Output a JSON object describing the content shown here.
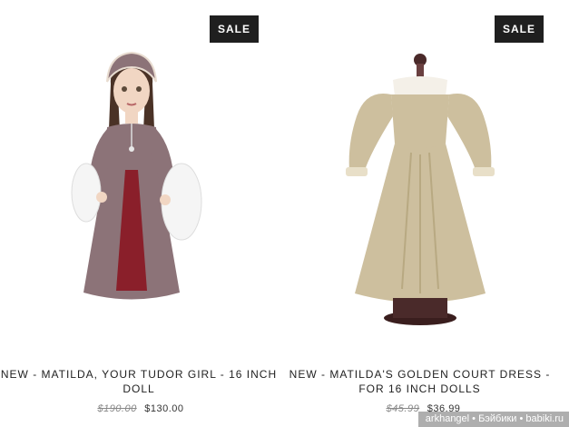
{
  "products": [
    {
      "badge": "SALE",
      "title": "NEW - MATILDA, YOUR TUDOR GIRL - 16 INCH DOLL",
      "old_price": "$190.00",
      "price": "$130.00"
    },
    {
      "badge": "SALE",
      "title": "NEW - MATILDA'S GOLDEN COURT DRESS - FOR 16 INCH DOLLS",
      "old_price": "$45.99",
      "price": "$36.99"
    }
  ],
  "watermark": "arkhangel • Бэйбики • babiki.ru",
  "colors": {
    "badge_bg": "#1f1f1f",
    "velvet_dress": "#8c7378",
    "underskirt": "#8a1f2a",
    "gold_brocade": "#cdbf9e"
  }
}
